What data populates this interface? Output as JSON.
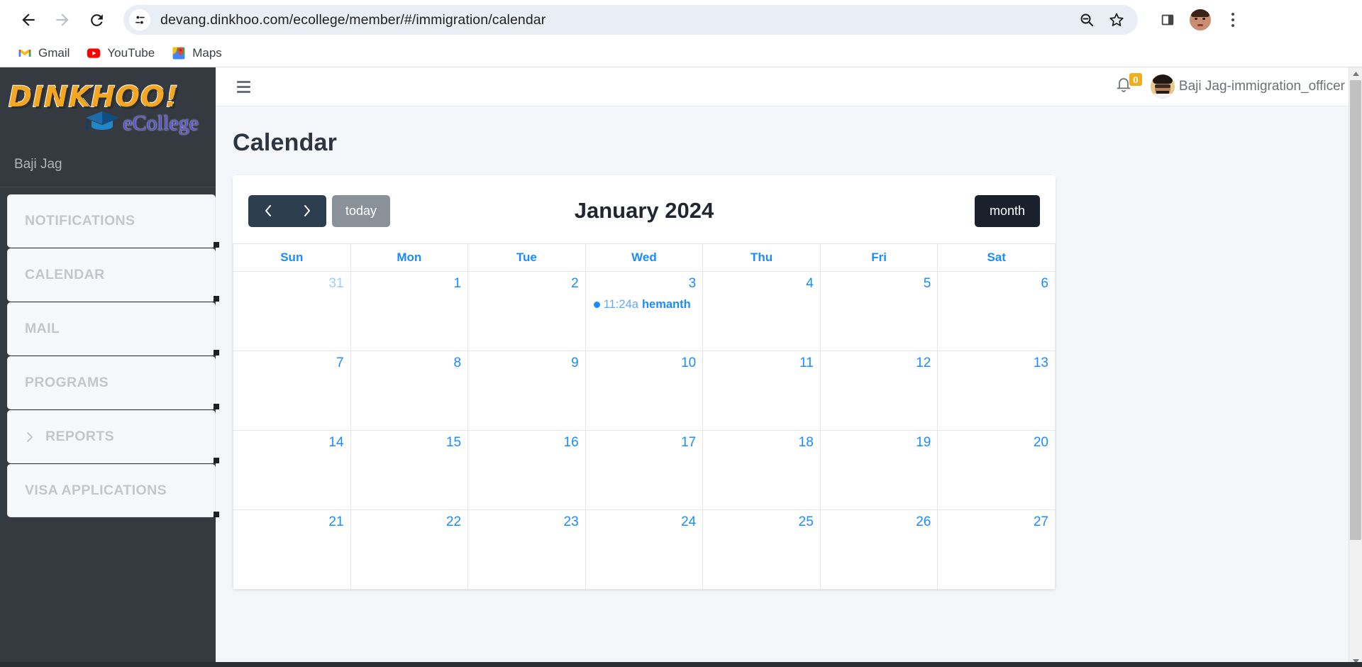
{
  "browser": {
    "url": "devang.dinkhoo.com/ecollege/member/#/immigration/calendar",
    "back_label": "Back",
    "forward_label": "Forward",
    "reload_label": "Reload",
    "site_info_label": "View site information",
    "zoom_label": "Zoom out",
    "bookmark_label": "Bookmark this tab",
    "side_panel_label": "Side panel",
    "profile_label": "Profile",
    "menu_label": "Customize and control Chrome",
    "bookmarks": [
      {
        "label": "Gmail",
        "icon": "gmail-icon"
      },
      {
        "label": "YouTube",
        "icon": "youtube-icon"
      },
      {
        "label": "Maps",
        "icon": "maps-icon"
      }
    ]
  },
  "sidebar": {
    "logo_main": "DINKHOO!",
    "logo_sub": "eCollege",
    "user": "Baji Jag",
    "items": [
      {
        "label": "NOTIFICATIONS",
        "chevron": false
      },
      {
        "label": "CALENDAR",
        "chevron": false
      },
      {
        "label": "MAIL",
        "chevron": false
      },
      {
        "label": "PROGRAMS",
        "chevron": false
      },
      {
        "label": "REPORTS",
        "chevron": true
      },
      {
        "label": "VISA APPLICATIONS",
        "chevron": false
      }
    ]
  },
  "topbar": {
    "menu_toggle_label": "Toggle navigation",
    "notification_count": "0",
    "user_name": "Baji Jag-immigration_officer"
  },
  "page": {
    "title": "Calendar"
  },
  "calendar": {
    "prev_label": "‹",
    "next_label": "›",
    "today_label": "today",
    "view_label": "month",
    "title": "January 2024",
    "weekdays": [
      "Sun",
      "Mon",
      "Tue",
      "Wed",
      "Thu",
      "Fri",
      "Sat"
    ],
    "accent_color": "#1a8cff",
    "today_cell_color": "#fcf8e3",
    "weeks": [
      [
        {
          "day": "31",
          "other": true,
          "today": false,
          "events": []
        },
        {
          "day": "1",
          "other": false,
          "today": false,
          "events": []
        },
        {
          "day": "2",
          "other": false,
          "today": false,
          "events": []
        },
        {
          "day": "3",
          "other": false,
          "today": false,
          "events": [
            {
              "time": "11:24a",
              "title": "hemanth"
            }
          ]
        },
        {
          "day": "4",
          "other": false,
          "today": false,
          "events": []
        },
        {
          "day": "5",
          "other": false,
          "today": false,
          "events": []
        },
        {
          "day": "6",
          "other": false,
          "today": false,
          "events": []
        }
      ],
      [
        {
          "day": "7",
          "other": false,
          "today": false,
          "events": []
        },
        {
          "day": "8",
          "other": false,
          "today": false,
          "events": []
        },
        {
          "day": "9",
          "other": false,
          "today": false,
          "events": []
        },
        {
          "day": "10",
          "other": false,
          "today": false,
          "events": []
        },
        {
          "day": "11",
          "other": false,
          "today": false,
          "events": []
        },
        {
          "day": "12",
          "other": false,
          "today": false,
          "events": []
        },
        {
          "day": "13",
          "other": false,
          "today": false,
          "events": []
        }
      ],
      [
        {
          "day": "14",
          "other": false,
          "today": false,
          "events": []
        },
        {
          "day": "15",
          "other": false,
          "today": false,
          "events": []
        },
        {
          "day": "16",
          "other": false,
          "today": false,
          "events": []
        },
        {
          "day": "17",
          "other": false,
          "today": false,
          "events": []
        },
        {
          "day": "18",
          "other": false,
          "today": false,
          "events": []
        },
        {
          "day": "19",
          "other": false,
          "today": false,
          "events": []
        },
        {
          "day": "20",
          "other": false,
          "today": false,
          "events": []
        }
      ],
      [
        {
          "day": "21",
          "other": false,
          "today": false,
          "events": []
        },
        {
          "day": "22",
          "other": false,
          "today": false,
          "events": []
        },
        {
          "day": "23",
          "other": false,
          "today": false,
          "events": []
        },
        {
          "day": "24",
          "other": false,
          "today": true,
          "events": []
        },
        {
          "day": "25",
          "other": false,
          "today": false,
          "events": []
        },
        {
          "day": "26",
          "other": false,
          "today": false,
          "events": []
        },
        {
          "day": "27",
          "other": false,
          "today": false,
          "events": []
        }
      ]
    ]
  }
}
